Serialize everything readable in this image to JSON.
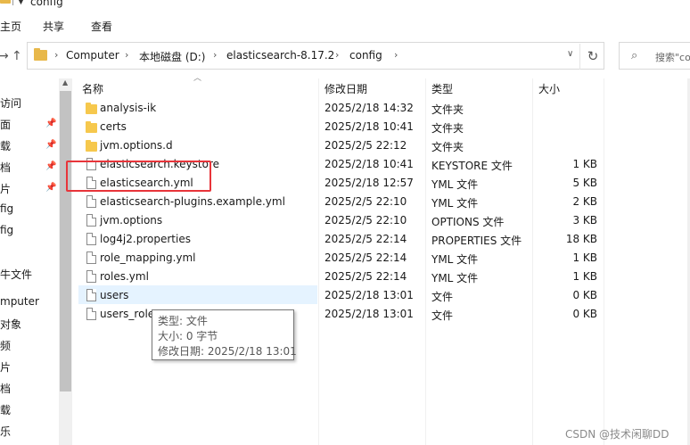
{
  "window": {
    "title": "config"
  },
  "ribbon": {
    "tabs": [
      "主页",
      "共享",
      "查看"
    ]
  },
  "address": {
    "crumbs": [
      "Computer",
      "本地磁盘 (D:)",
      "elasticsearch-8.17.2",
      "config"
    ],
    "search_placeholder": "搜索\"config\""
  },
  "nav": {
    "items": [
      "访问",
      "面",
      "载",
      "档",
      "片",
      "fig",
      "fig",
      "牛文件",
      "mputer",
      "对象",
      "频",
      "片",
      "档",
      "载",
      "乐"
    ]
  },
  "columns": {
    "name": "名称",
    "modified": "修改日期",
    "type": "类型",
    "size": "大小"
  },
  "files": [
    {
      "name": "analysis-ik",
      "modified": "2025/2/18 14:32",
      "type": "文件夹",
      "size": "",
      "icon": "folder-icon"
    },
    {
      "name": "certs",
      "modified": "2025/2/18 10:41",
      "type": "文件夹",
      "size": "",
      "icon": "folder-icon"
    },
    {
      "name": "jvm.options.d",
      "modified": "2025/2/5 22:12",
      "type": "文件夹",
      "size": "",
      "icon": "folder-icon"
    },
    {
      "name": "elasticsearch.keystore",
      "modified": "2025/2/18 10:41",
      "type": "KEYSTORE 文件",
      "size": "1 KB",
      "icon": "file-icon"
    },
    {
      "name": "elasticsearch.yml",
      "modified": "2025/2/18 12:57",
      "type": "YML 文件",
      "size": "5 KB",
      "icon": "file-icon"
    },
    {
      "name": "elasticsearch-plugins.example.yml",
      "modified": "2025/2/5 22:10",
      "type": "YML 文件",
      "size": "2 KB",
      "icon": "file-icon"
    },
    {
      "name": "jvm.options",
      "modified": "2025/2/5 22:10",
      "type": "OPTIONS 文件",
      "size": "3 KB",
      "icon": "file-icon"
    },
    {
      "name": "log4j2.properties",
      "modified": "2025/2/5 22:14",
      "type": "PROPERTIES 文件",
      "size": "18 KB",
      "icon": "file-icon"
    },
    {
      "name": "role_mapping.yml",
      "modified": "2025/2/5 22:14",
      "type": "YML 文件",
      "size": "1 KB",
      "icon": "file-icon"
    },
    {
      "name": "roles.yml",
      "modified": "2025/2/5 22:14",
      "type": "YML 文件",
      "size": "1 KB",
      "icon": "file-icon"
    },
    {
      "name": "users",
      "modified": "2025/2/18 13:01",
      "type": "文件",
      "size": "0 KB",
      "icon": "file-icon"
    },
    {
      "name": "users_roles",
      "modified": "2025/2/18 13:01",
      "type": "文件",
      "size": "0 KB",
      "icon": "file-icon"
    }
  ],
  "tooltip": {
    "type_line": "类型: 文件",
    "size_line": "大小: 0 字节",
    "modified_line": "修改日期: 2025/2/18 13:01"
  },
  "watermark": "CSDN @技术闲聊DD",
  "colors": {
    "annotation": "#e8343a",
    "selection": "#e5f3ff",
    "folder": "#f6c84d"
  }
}
